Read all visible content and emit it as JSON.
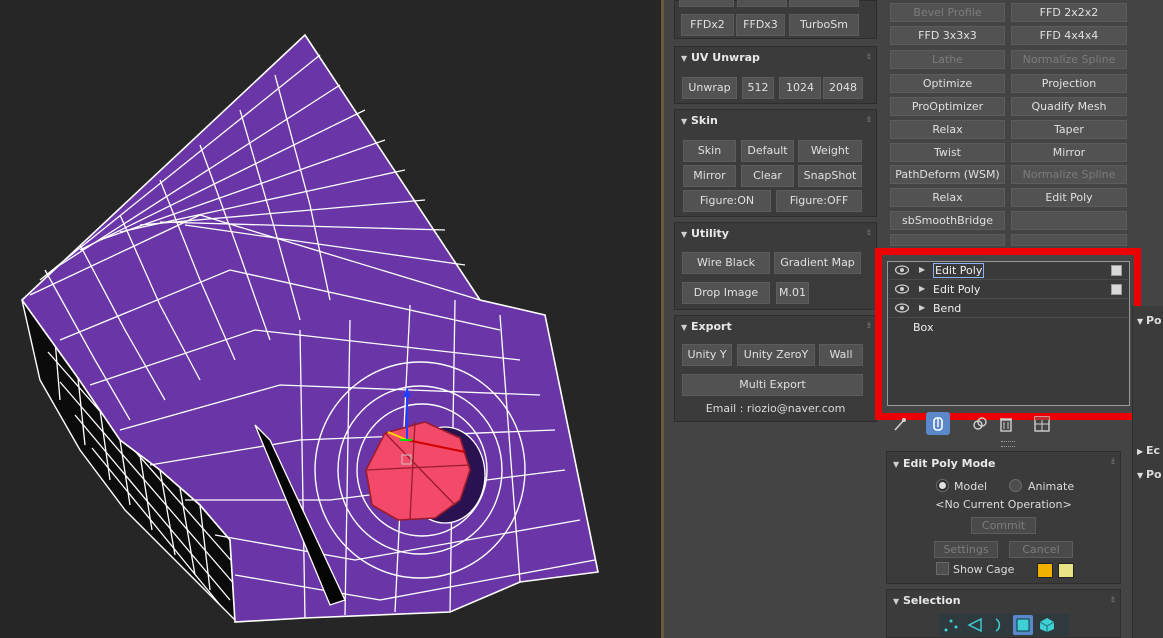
{
  "viewport": {
    "mesh_color": "#6a35a6",
    "selection_color": "#f24a68"
  },
  "colors": {
    "panel": "#444444",
    "button": "#525252",
    "highlight": "#ee0000",
    "swatch_orange": "#f1b100",
    "swatch_yellow": "#e9e385"
  },
  "ffd_rollout": {
    "buttons": [
      "FFDx2",
      "FFDx3",
      "TurboSm"
    ]
  },
  "uv_unwrap": {
    "title": "UV Unwrap",
    "buttons": [
      "Unwrap",
      "512",
      "1024",
      "2048"
    ]
  },
  "skin": {
    "title": "Skin",
    "buttons": [
      "Skin",
      "Default",
      "Weight",
      "Mirror",
      "Clear",
      "SnapShot",
      "Figure:ON",
      "Figure:OFF"
    ]
  },
  "utility": {
    "title": "Utility",
    "buttons": [
      "Wire Black",
      "Gradient Map",
      "Drop Image",
      "M.01"
    ]
  },
  "export": {
    "title": "Export",
    "buttons": [
      "Unity Y",
      "Unity ZeroY",
      "Wall",
      "Multi Export"
    ],
    "email": "Email : riozio@naver.com"
  },
  "modifier_buttons": [
    "Bevel Profile",
    "FFD 2x2x2",
    "FFD 3x3x3",
    "FFD 4x4x4",
    "Lathe",
    "Normalize Spline",
    "Optimize",
    "Projection",
    "ProOptimizer",
    "Quadify Mesh",
    "Relax",
    "Taper",
    "Twist",
    "Mirror",
    "PathDeform (WSM)",
    "Normalize Spline",
    "Relax",
    "Edit Poly",
    "sbSmoothBridge"
  ],
  "modifier_stack": {
    "items": [
      "Edit Poly",
      "Edit Poly",
      "Bend"
    ],
    "base": "Box"
  },
  "edit_poly_mode": {
    "title": "Edit Poly Mode",
    "model": "Model",
    "animate": "Animate",
    "operation": "<No Current Operation>",
    "commit": "Commit",
    "settings": "Settings",
    "cancel": "Cancel",
    "show_cage": "Show Cage"
  },
  "selection": {
    "title": "Selection"
  },
  "right_edge": {
    "labels": [
      "Po",
      "Ec",
      "Po"
    ]
  }
}
